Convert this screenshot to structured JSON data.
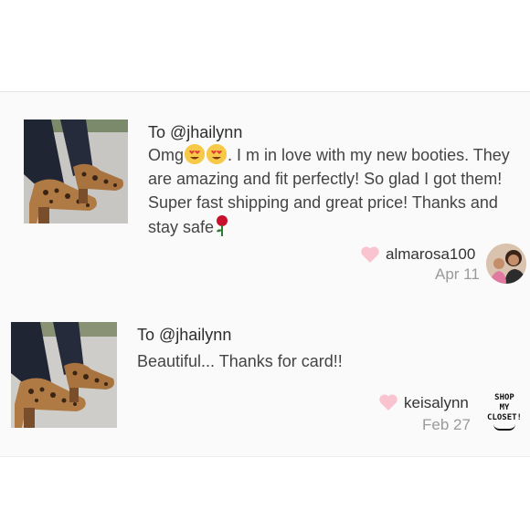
{
  "reviews": [
    {
      "to_label": "To @jhailynn",
      "message_parts": [
        "Omg",
        ". I m in love with my new booties. They are amazing and fit perfectly! So glad I got them! Super fast shipping and great price! Thanks and stay safe"
      ],
      "username": "almarosa100",
      "date": "Apr 11",
      "emojis": [
        "heart-eyes",
        "heart-eyes",
        "rose"
      ]
    },
    {
      "to_label": "To @jhailynn",
      "message": "Beautiful... Thanks for card!!",
      "username": "keisalynn",
      "date": "Feb 27",
      "badge_lines": [
        "SHOP",
        "MY",
        "CLOSET!"
      ]
    }
  ],
  "colors": {
    "heart": "#f9c4cf",
    "text": "#444444",
    "muted": "#9a9a9a",
    "leopard": "#b07a44"
  }
}
